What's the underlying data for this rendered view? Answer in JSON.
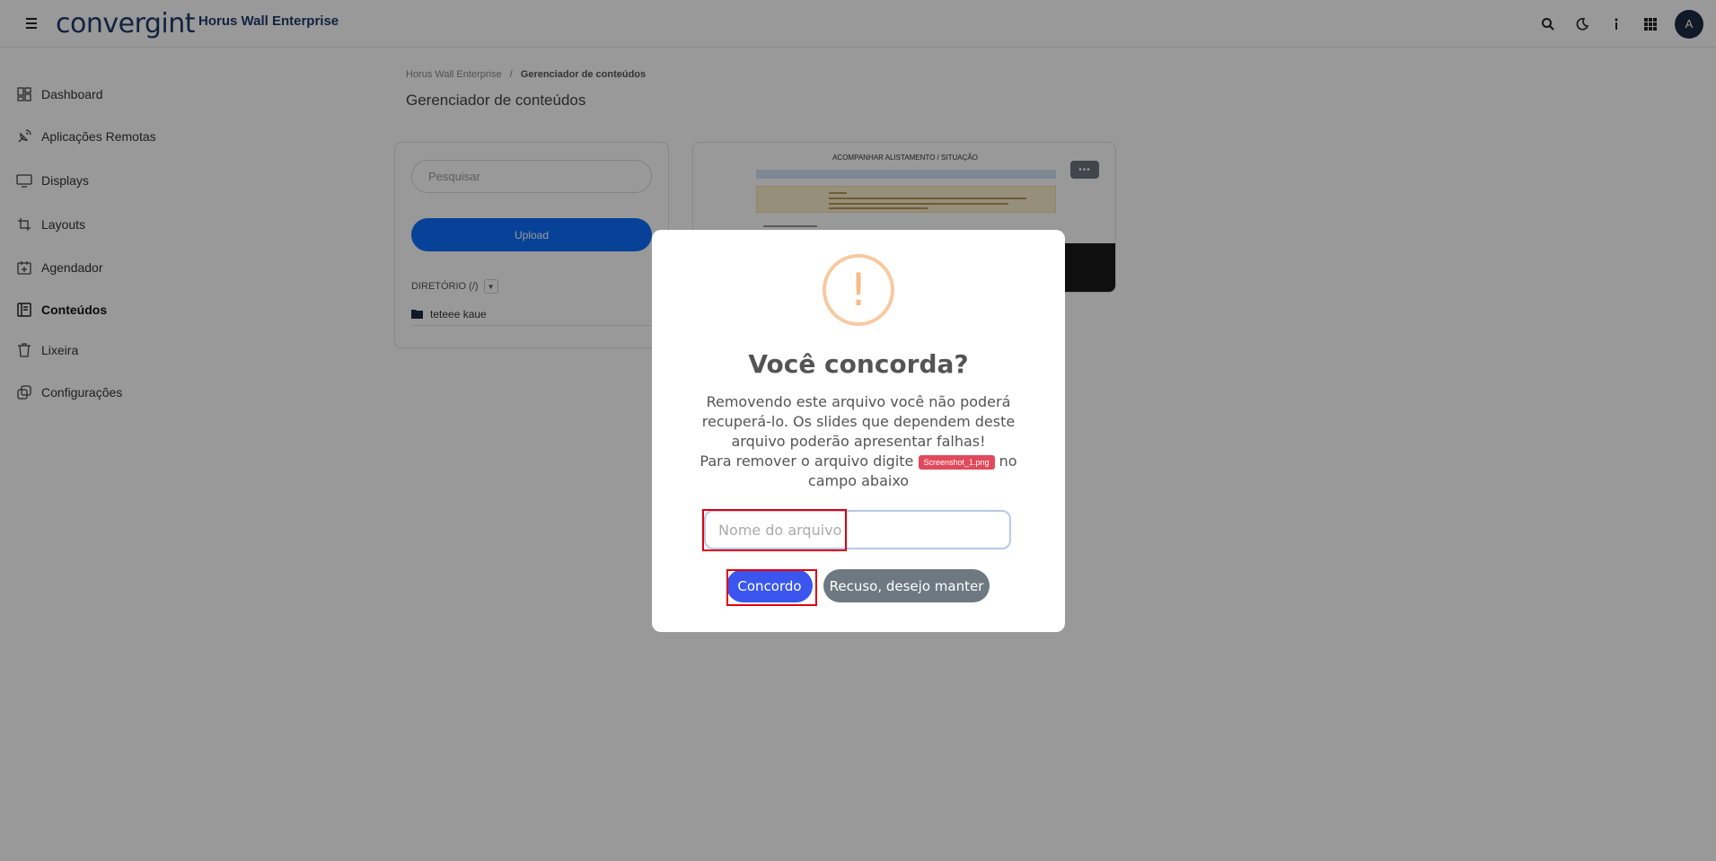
{
  "header": {
    "logo_text": "convergint",
    "app_title": "Horus Wall Enterprise",
    "avatar_initial": "A",
    "icons": [
      "search-icon",
      "moon-icon",
      "info-icon",
      "apps-grid-icon"
    ]
  },
  "sidebar": {
    "items": [
      {
        "label": "Dashboard",
        "icon": "dashboard-icon"
      },
      {
        "label": "Aplicações Remotas",
        "icon": "satellite-icon"
      },
      {
        "label": "Displays",
        "icon": "monitor-icon"
      },
      {
        "label": "Layouts",
        "icon": "crop-icon"
      },
      {
        "label": "Agendador",
        "icon": "calendar-icon"
      },
      {
        "label": "Conteúdos",
        "icon": "content-icon"
      },
      {
        "label": "Lixeira",
        "icon": "trash-icon"
      },
      {
        "label": "Configurações",
        "icon": "settings-icon"
      }
    ],
    "active": "Conteúdos"
  },
  "main": {
    "breadcrumb_root": "Horus Wall Enterprise",
    "breadcrumb_separator": "/",
    "breadcrumb_current": "Gerenciador de conteúdos",
    "page_title": "Gerenciador de conteúdos",
    "search_placeholder": "Pesquisar",
    "upload_label": "Upload",
    "directory_label": "DIRETÓRIO (/)",
    "folders": [
      {
        "name": "teteee kaue"
      }
    ],
    "thumbnail_title": "ACOMPANHAR ALISTAMENTO / SITUAÇÃO",
    "more_label": "•••"
  },
  "modal": {
    "title": "Você concorda?",
    "icon": "!",
    "message": "Removendo este arquivo você não poderá recuperá-lo. Os slides que dependem deste arquivo poderão apresentar falhas!",
    "instruction_before": "Para remover o arquivo digite",
    "file_name": "Screenshot_1.png",
    "instruction_after": "no campo abaixo",
    "input_placeholder": "Nome do arquivo",
    "confirm_label": "Concordo",
    "cancel_label": "Recuso, desejo manter"
  },
  "colors": {
    "primary": "#0d6efd",
    "confirm": "#3a56ee",
    "cancel": "#6e7881",
    "badge": "#e24a5b",
    "annotation": "#e0000e",
    "warning": "#f8bb86"
  }
}
